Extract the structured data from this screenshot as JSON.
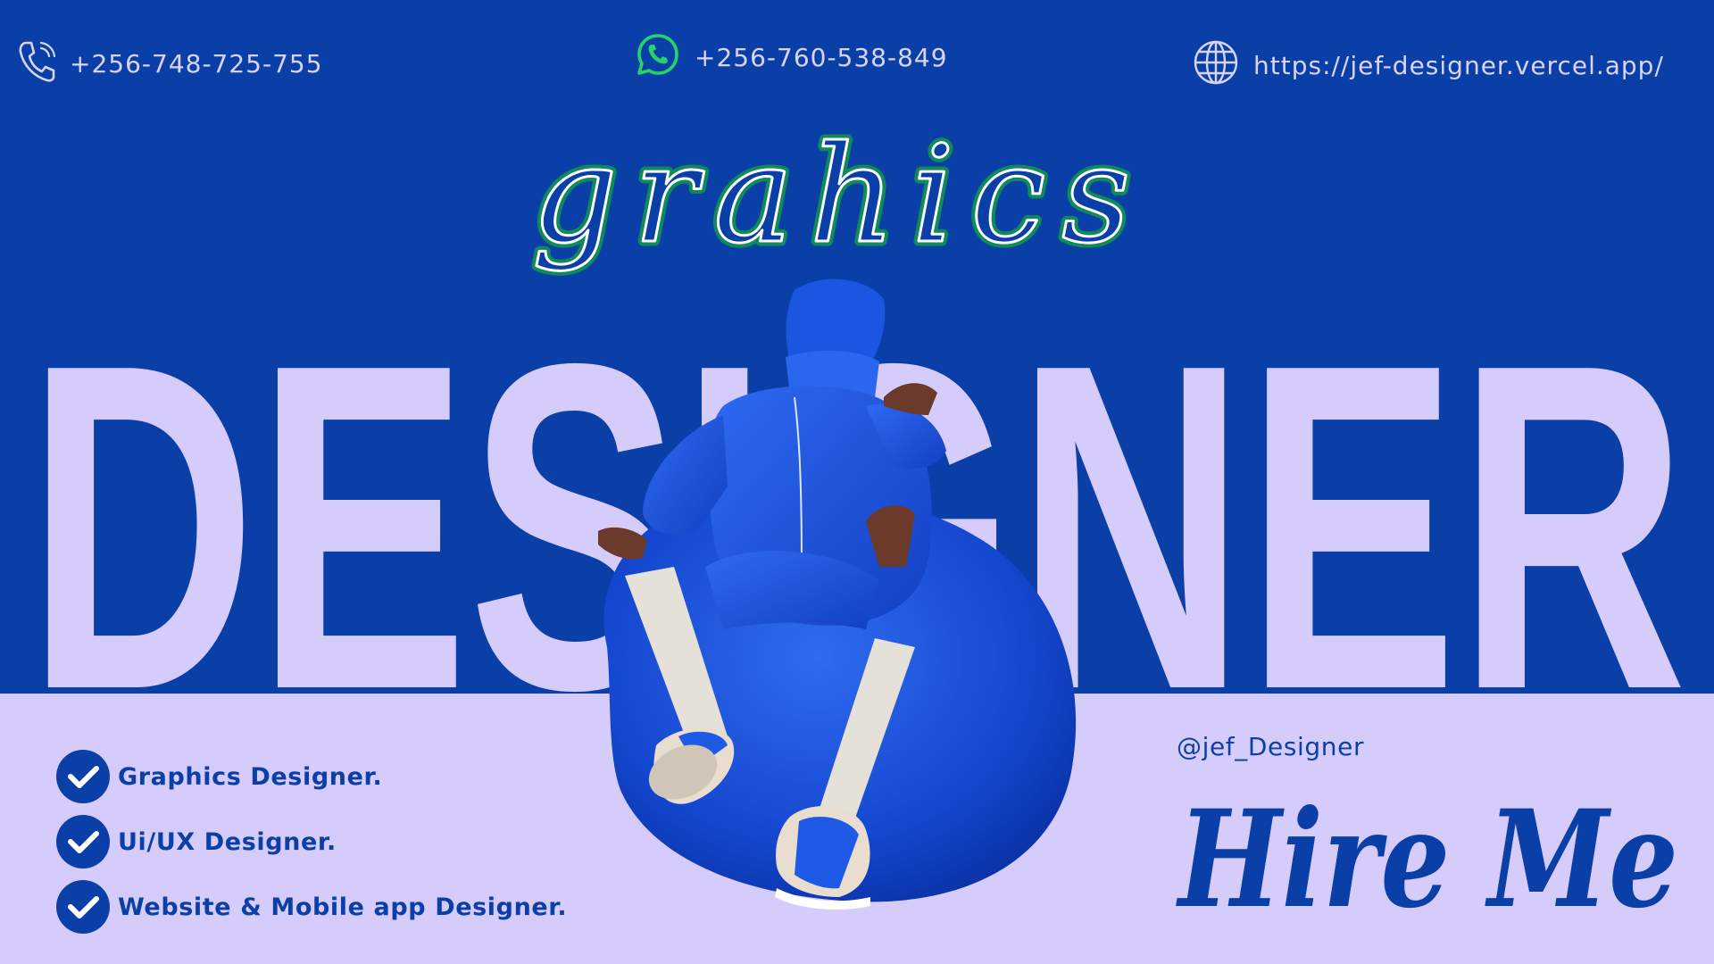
{
  "contact": {
    "phone": "+256-748-725-755",
    "whatsapp": "+256-760-538-849",
    "website": "https://jef-designer.vercel.app/",
    "phone_icon": "phone-icon",
    "whatsapp_icon": "whatsapp-icon",
    "globe_icon": "globe-icon"
  },
  "hero": {
    "script_word": "grahics",
    "big_word": "DESIGNER"
  },
  "services": [
    {
      "label": "Graphics Designer.",
      "icon": "check-circle-icon"
    },
    {
      "label": "Ui/UX Designer.",
      "icon": "check-circle-icon"
    },
    {
      "label": "Website & Mobile app Designer.",
      "icon": "check-circle-icon"
    }
  ],
  "social": {
    "handle": "@jef_Designer"
  },
  "cta": {
    "label": "Hire Me"
  },
  "colors": {
    "background": "#0a3fa8",
    "band": "#d6ccfc",
    "text_light": "#d9d4f5",
    "script_green": "#0f8a5a",
    "whatsapp_green": "#25d366",
    "figure_blue": "#1a56e0"
  }
}
